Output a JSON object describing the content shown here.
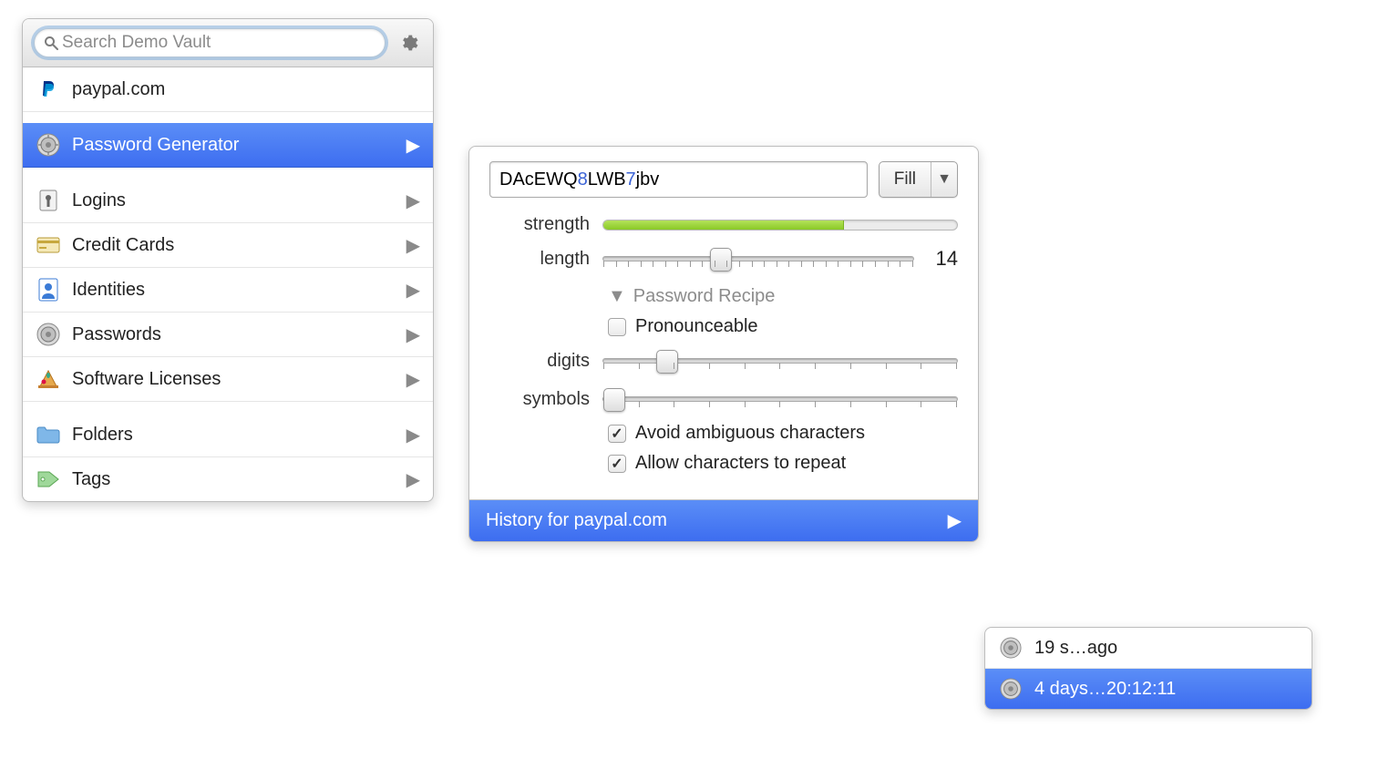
{
  "search": {
    "placeholder": "Search Demo Vault"
  },
  "site": {
    "name": "paypal.com"
  },
  "sidebar": {
    "generator": "Password Generator",
    "categories": [
      {
        "label": "Logins"
      },
      {
        "label": "Credit Cards"
      },
      {
        "label": "Identities"
      },
      {
        "label": "Passwords"
      },
      {
        "label": "Software Licenses"
      }
    ],
    "groups": [
      {
        "label": "Folders"
      },
      {
        "label": "Tags"
      }
    ]
  },
  "generator": {
    "password_parts": [
      {
        "t": "DAcEWQ",
        "d": false
      },
      {
        "t": "8",
        "d": true
      },
      {
        "t": "LWB",
        "d": false
      },
      {
        "t": "7",
        "d": true
      },
      {
        "t": "jbv",
        "d": false
      }
    ],
    "fill_label": "Fill",
    "strength_label": "strength",
    "strength_pct": 68,
    "length_label": "length",
    "length_value": "14",
    "length_thumb_pct": 38,
    "recipe_header": "Password Recipe",
    "pronounceable_label": "Pronounceable",
    "pronounceable_checked": false,
    "digits_label": "digits",
    "digits_thumb_pct": 18,
    "symbols_label": "symbols",
    "symbols_thumb_pct": 3,
    "avoid_label": "Avoid ambiguous characters",
    "avoid_checked": true,
    "repeat_label": "Allow characters to repeat",
    "repeat_checked": true,
    "history_label": "History for paypal.com"
  },
  "history": {
    "items": [
      {
        "label": "19 s…ago",
        "selected": false
      },
      {
        "label": "4 days…20:12:11",
        "selected": true
      }
    ]
  }
}
